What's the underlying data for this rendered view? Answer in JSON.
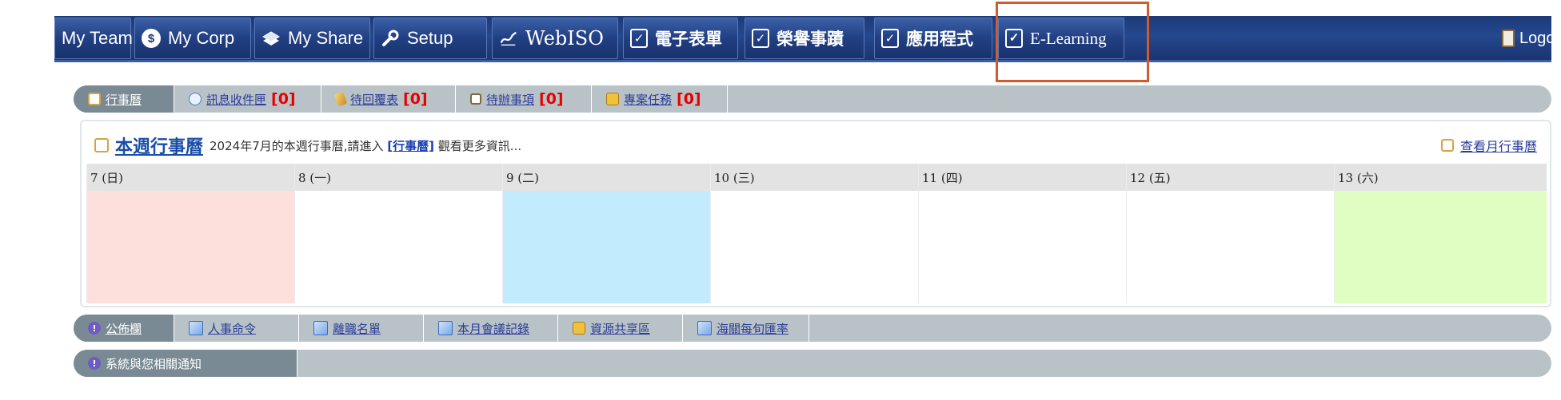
{
  "nav": {
    "items": [
      {
        "label": "My Team",
        "icon": "none"
      },
      {
        "label": "My Corp",
        "icon": "dollar-coin-icon"
      },
      {
        "label": "My Share",
        "icon": "share-books-icon"
      },
      {
        "label": "Setup",
        "icon": "wrench-icon"
      },
      {
        "label": "WebISO",
        "icon": "pen-signature-icon"
      },
      {
        "label": "電子表單",
        "icon": "checkbox-icon"
      },
      {
        "label": "榮譽事蹟",
        "icon": "checkbox-icon"
      },
      {
        "label": "應用程式",
        "icon": "checkbox-icon"
      },
      {
        "label": "E-Learning",
        "icon": "checkbox-icon"
      }
    ],
    "logout": "Logout",
    "highlight_color": "#d25a2c",
    "bar_color": "#1d3a78"
  },
  "tabs": {
    "items": [
      {
        "label": "行事曆",
        "count": "",
        "icon": "calendar-icon"
      },
      {
        "label": "訊息收件匣",
        "count": "[0]",
        "icon": "speech-bubble-icon"
      },
      {
        "label": "待回覆表",
        "count": "[0]",
        "icon": "pencil-icon"
      },
      {
        "label": "待辦事項",
        "count": "[0]",
        "icon": "todo-checkbox-icon"
      },
      {
        "label": "專案任務",
        "count": "[0]",
        "icon": "folder-tag-icon"
      }
    ]
  },
  "calendar": {
    "title": "本週行事曆",
    "description": "2024年7月的本週行事曆,請進入",
    "link": "[行事曆]",
    "description_suffix": "觀看更多資訊...",
    "month_link": "查看月行事曆",
    "days": [
      {
        "label": "7 (日)",
        "color": "#fde0db"
      },
      {
        "label": "8 (一)",
        "color": "#ffffff"
      },
      {
        "label": "9 (二)",
        "color": "#c2ecfd"
      },
      {
        "label": "10 (三)",
        "color": "#ffffff"
      },
      {
        "label": "11 (四)",
        "color": "#ffffff"
      },
      {
        "label": "12 (五)",
        "color": "#ffffff"
      },
      {
        "label": "13 (六)",
        "color": "#e0fdc2"
      }
    ]
  },
  "bulletin": {
    "items": [
      {
        "label": "公佈欄"
      },
      {
        "label": "人事命令"
      },
      {
        "label": "離職名單"
      },
      {
        "label": "本月會議記錄"
      },
      {
        "label": "資源共享區"
      },
      {
        "label": "海關每旬匯率"
      }
    ]
  },
  "notice": {
    "label": "系統與您相關通知"
  }
}
